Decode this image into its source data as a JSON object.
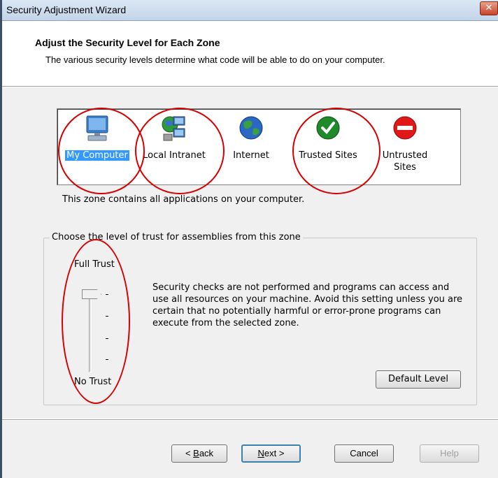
{
  "window": {
    "title": "Security Adjustment Wizard",
    "close_symbol": "✕"
  },
  "header": {
    "heading": "Adjust the Security Level for Each Zone",
    "description": "The various security levels determine what code will be able to do on your computer."
  },
  "zones": [
    {
      "label": "My Computer",
      "icon": "my-computer-icon",
      "selected": true
    },
    {
      "label": "Local Intranet",
      "icon": "local-intranet-icon",
      "selected": false
    },
    {
      "label": "Internet",
      "icon": "internet-globe-icon",
      "selected": false
    },
    {
      "label": "Trusted Sites",
      "icon": "trusted-sites-icon",
      "selected": false
    },
    {
      "label": "Untrusted Sites",
      "icon": "untrusted-sites-icon",
      "selected": false
    }
  ],
  "zone_description": "This zone contains all applications on your computer.",
  "trust": {
    "group_label": "Choose the level of trust for assemblies from this zone",
    "top_label": "Full Trust",
    "bottom_label": "No Trust",
    "slider_level": "Full Trust",
    "description": "Security checks are not performed and programs can access and use all resources on your machine.  Avoid this setting unless you are certain that no potentially harmful or error-prone programs can execute from the selected zone.",
    "default_button": "Default Level"
  },
  "buttons": {
    "back_prefix": "< ",
    "back_mnemonic": "B",
    "back_rest": "ack",
    "next_mnemonic": "N",
    "next_rest": "ext >",
    "cancel": "Cancel",
    "help": "Help"
  },
  "colors": {
    "selection": "#3399ff",
    "annotation": "#d60000",
    "title_bar": "#c3d5ea"
  }
}
